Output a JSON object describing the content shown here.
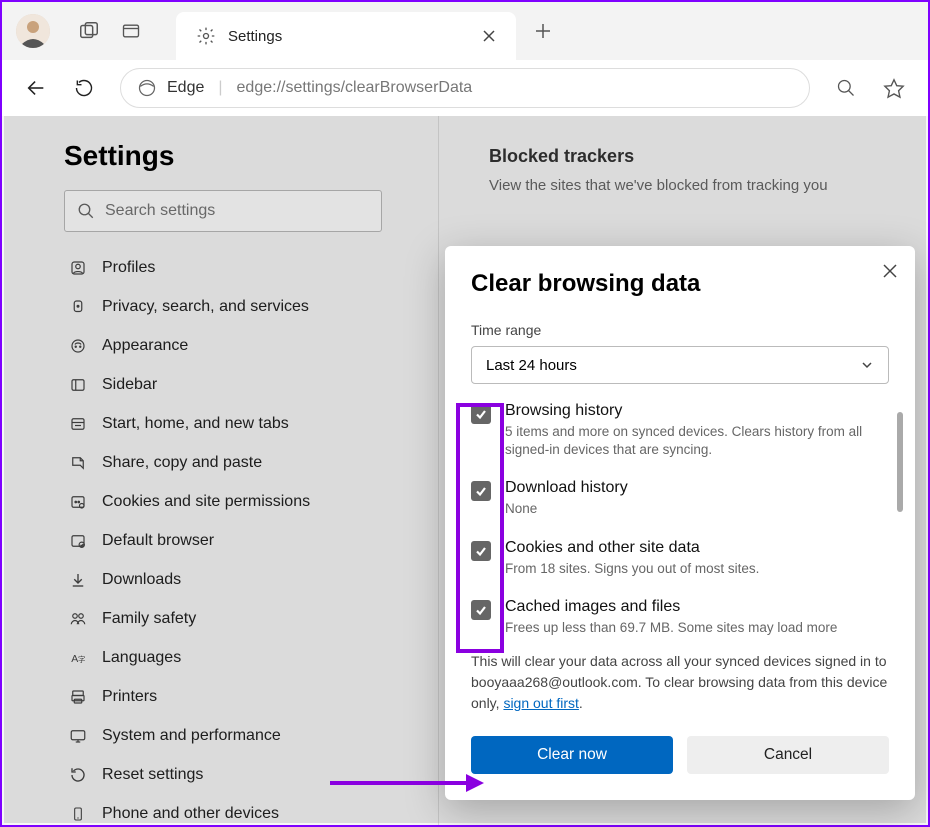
{
  "titlebar": {
    "tab_title": "Settings"
  },
  "addressbar": {
    "protocol_label": "Edge",
    "url": "edge://settings/clearBrowserData"
  },
  "sidebar": {
    "heading": "Settings",
    "search_placeholder": "Search settings",
    "items": [
      {
        "label": "Profiles"
      },
      {
        "label": "Privacy, search, and services"
      },
      {
        "label": "Appearance"
      },
      {
        "label": "Sidebar"
      },
      {
        "label": "Start, home, and new tabs"
      },
      {
        "label": "Share, copy and paste"
      },
      {
        "label": "Cookies and site permissions"
      },
      {
        "label": "Default browser"
      },
      {
        "label": "Downloads"
      },
      {
        "label": "Family safety"
      },
      {
        "label": "Languages"
      },
      {
        "label": "Printers"
      },
      {
        "label": "System and performance"
      },
      {
        "label": "Reset settings"
      },
      {
        "label": "Phone and other devices"
      }
    ]
  },
  "main": {
    "blocked_heading": "Blocked trackers",
    "blocked_sub": "View the sites that we've blocked from tracking you"
  },
  "dialog": {
    "title": "Clear browsing data",
    "timerange_label": "Time range",
    "timerange_value": "Last 24 hours",
    "items": [
      {
        "title": "Browsing history",
        "desc": "5 items and more on synced devices. Clears history from all signed-in devices that are syncing."
      },
      {
        "title": "Download history",
        "desc": "None"
      },
      {
        "title": "Cookies and other site data",
        "desc": "From 18 sites. Signs you out of most sites."
      },
      {
        "title": "Cached images and files",
        "desc": "Frees up less than 69.7 MB. Some sites may load more"
      }
    ],
    "notice_prefix": "This will clear your data across all your synced devices signed in to booyaaa268@outlook.com. To clear browsing data from this device only, ",
    "notice_link": "sign out first",
    "notice_suffix": ".",
    "clear_btn": "Clear now",
    "cancel_btn": "Cancel"
  }
}
